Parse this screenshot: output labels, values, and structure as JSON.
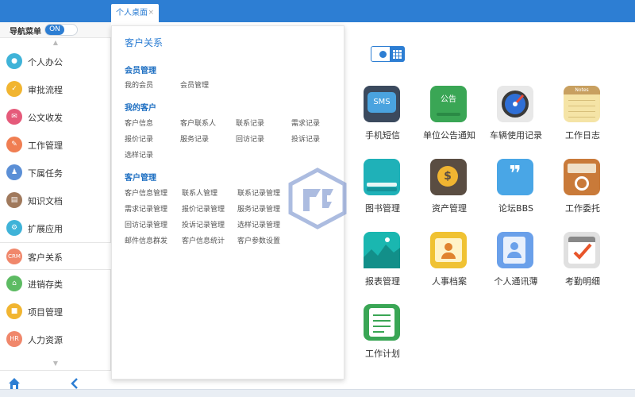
{
  "tabs": [
    {
      "label": "个人桌面",
      "close": "×"
    }
  ],
  "nav_header": {
    "label": "导航菜单",
    "toggle": "ON"
  },
  "sidebar": {
    "items": [
      {
        "label": "个人办公",
        "color": "#3fb3d8",
        "icon": "person-icon"
      },
      {
        "label": "审批流程",
        "color": "#f1b531",
        "icon": "approval-icon"
      },
      {
        "label": "公文收发",
        "color": "#e55a7a",
        "icon": "document-icon"
      },
      {
        "label": "工作管理",
        "color": "#f07e52",
        "icon": "work-icon"
      },
      {
        "label": "下属任务",
        "color": "#5b8fd6",
        "icon": "team-icon"
      },
      {
        "label": "知识文档",
        "color": "#a0795c",
        "icon": "book-icon"
      },
      {
        "label": "扩展应用",
        "color": "#3fb3d8",
        "icon": "extension-icon"
      },
      {
        "label": "客户关系",
        "color": "#f0876b",
        "icon": "crm-icon",
        "badge": "CRM"
      },
      {
        "label": "进销存类",
        "color": "#5dbb63",
        "icon": "inventory-icon"
      },
      {
        "label": "项目管理",
        "color": "#f1b531",
        "icon": "project-icon"
      },
      {
        "label": "人力资源",
        "color": "#f0876b",
        "icon": "hr-icon",
        "badge": "HR"
      }
    ]
  },
  "panel": {
    "title": "客户关系",
    "sections": [
      {
        "title": "会员管理",
        "links": [
          "我的会员",
          "会员管理"
        ]
      },
      {
        "title": "我的客户",
        "links": [
          "客户信息",
          "客户联系人",
          "联系记录",
          "需求记录",
          "报价记录",
          "服务记录",
          "回访记录",
          "投诉记录",
          "选样记录"
        ]
      },
      {
        "title": "客户管理",
        "links": [
          "客户信息管理",
          "联系人管理",
          "联系记录管理",
          "需求记录管理",
          "报价记录管理",
          "服务记录管理",
          "回访记录管理",
          "投诉记录管理",
          "选样记录管理",
          "邮件信息群发",
          "客户信息统计",
          "客户参数设置"
        ]
      }
    ]
  },
  "apps": [
    {
      "label": "手机短信",
      "icon": "sms-icon",
      "color": "#3b4a5e",
      "text": "SMS"
    },
    {
      "label": "单位公告通知",
      "icon": "notice-icon",
      "color": "#3aa655",
      "text": "公告"
    },
    {
      "label": "车辆使用记录",
      "icon": "speedometer-icon",
      "color": "#e8e8e8"
    },
    {
      "label": "工作日志",
      "icon": "notes-icon",
      "color": "#f5e4a6",
      "text": "Notes"
    },
    {
      "label": "图书管理",
      "icon": "book-icon",
      "color": "#1fb1b8"
    },
    {
      "label": "资产管理",
      "icon": "asset-icon",
      "color": "#5a4d42"
    },
    {
      "label": "论坛BBS",
      "icon": "forum-icon",
      "color": "#49a6e6"
    },
    {
      "label": "工作委托",
      "icon": "delegate-icon",
      "color": "#c97a39"
    },
    {
      "label": "报表管理",
      "icon": "chart-icon",
      "color": "#1ab7b0"
    },
    {
      "label": "人事档案",
      "icon": "personnel-icon",
      "color": "#f0c232"
    },
    {
      "label": "个人通讯薄",
      "icon": "contacts-icon",
      "color": "#6aa0ea"
    },
    {
      "label": "考勤明细",
      "icon": "attendance-icon",
      "color": "#e0e0e0"
    },
    {
      "label": "工作计划",
      "icon": "plan-icon",
      "color": "#3aa655"
    }
  ]
}
